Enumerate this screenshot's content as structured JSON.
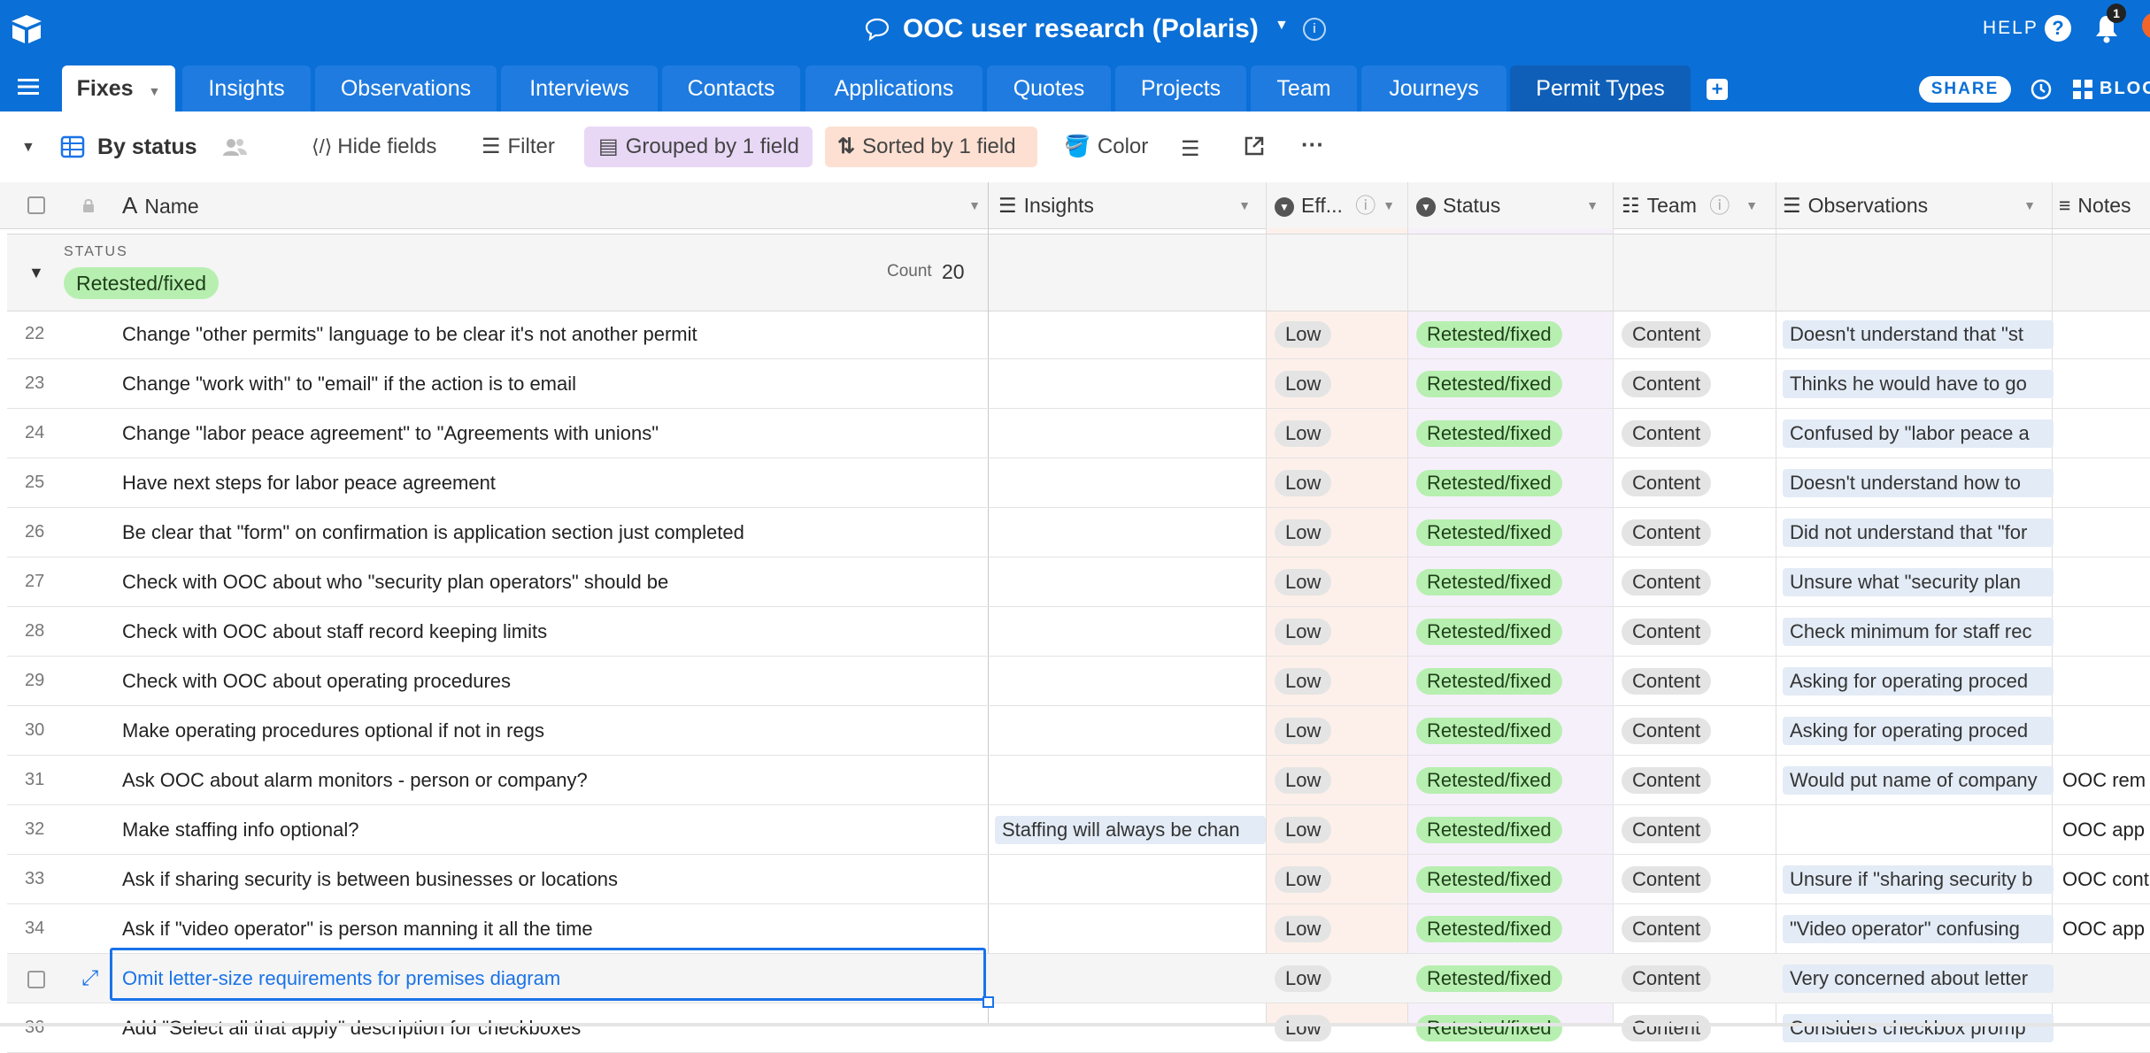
{
  "app": {
    "title": "OOC user research (Polaris)",
    "help_label": "HELP",
    "notification_count": "1",
    "share_label": "SHARE",
    "blocks_label": "BLOC"
  },
  "tabs": [
    {
      "label": "Fixes"
    },
    {
      "label": "Insights"
    },
    {
      "label": "Observations"
    },
    {
      "label": "Interviews"
    },
    {
      "label": "Contacts"
    },
    {
      "label": "Applications"
    },
    {
      "label": "Quotes"
    },
    {
      "label": "Projects"
    },
    {
      "label": "Team"
    },
    {
      "label": "Journeys"
    },
    {
      "label": "Permit Types"
    }
  ],
  "toolbar": {
    "view_name": "By status",
    "hide_fields": "Hide fields",
    "filter": "Filter",
    "grouped": "Grouped by 1 field",
    "sorted": "Sorted by 1 field",
    "color": "Color"
  },
  "columns": {
    "name": "Name",
    "insights": "Insights",
    "effort": "Eff...",
    "status": "Status",
    "team": "Team",
    "observations": "Observations",
    "notes": "Notes"
  },
  "group": {
    "field_label": "STATUS",
    "value": "Retested/fixed",
    "count_label": "Count",
    "count": "20"
  },
  "rows": [
    {
      "num": "22",
      "name": "Change \"other permits\" language to be clear it's not another permit",
      "insights": "",
      "effort": "Low",
      "status": "Retested/fixed",
      "team": "Content",
      "observations": "Doesn't understand that \"st",
      "notes": ""
    },
    {
      "num": "23",
      "name": "Change \"work with\" to \"email\" if the action is to email",
      "insights": "",
      "effort": "Low",
      "status": "Retested/fixed",
      "team": "Content",
      "observations": "Thinks he would have to go",
      "notes": ""
    },
    {
      "num": "24",
      "name": "Change \"labor peace agreement\" to \"Agreements with unions\"",
      "insights": "",
      "effort": "Low",
      "status": "Retested/fixed",
      "team": "Content",
      "observations": "Confused by \"labor peace a",
      "notes": ""
    },
    {
      "num": "25",
      "name": "Have next steps for labor peace agreement",
      "insights": "",
      "effort": "Low",
      "status": "Retested/fixed",
      "team": "Content",
      "observations": "Doesn't understand how to",
      "notes": ""
    },
    {
      "num": "26",
      "name": "Be clear that \"form\" on confirmation is application section just completed",
      "insights": "",
      "effort": "Low",
      "status": "Retested/fixed",
      "team": "Content",
      "observations": "Did not understand that \"for",
      "notes": ""
    },
    {
      "num": "27",
      "name": "Check with OOC about who \"security plan operators\" should be",
      "insights": "",
      "effort": "Low",
      "status": "Retested/fixed",
      "team": "Content",
      "observations": "Unsure what \"security plan",
      "notes": ""
    },
    {
      "num": "28",
      "name": "Check with OOC about staff record keeping limits",
      "insights": "",
      "effort": "Low",
      "status": "Retested/fixed",
      "team": "Content",
      "observations": "Check minimum for staff rec",
      "notes": ""
    },
    {
      "num": "29",
      "name": "Check with OOC about operating procedures",
      "insights": "",
      "effort": "Low",
      "status": "Retested/fixed",
      "team": "Content",
      "observations": "Asking for operating proced",
      "notes": ""
    },
    {
      "num": "30",
      "name": "Make operating procedures optional if not in regs",
      "insights": "",
      "effort": "Low",
      "status": "Retested/fixed",
      "team": "Content",
      "observations": "Asking for operating proced",
      "notes": ""
    },
    {
      "num": "31",
      "name": "Ask OOC about alarm monitors - person or company?",
      "insights": "",
      "effort": "Low",
      "status": "Retested/fixed",
      "team": "Content",
      "observations": "Would put name of company",
      "notes": "OOC rem"
    },
    {
      "num": "32",
      "name": "Make staffing info optional?",
      "insights": "Staffing will always be chan",
      "effort": "Low",
      "status": "Retested/fixed",
      "team": "Content",
      "observations": "",
      "notes": "OOC app"
    },
    {
      "num": "33",
      "name": "Ask if sharing security is between businesses or locations",
      "insights": "",
      "effort": "Low",
      "status": "Retested/fixed",
      "team": "Content",
      "observations": "Unsure if \"sharing security b",
      "notes": "OOC cont"
    },
    {
      "num": "34",
      "name": "Ask if \"video operator\" is person manning it all the time",
      "insights": "",
      "effort": "Low",
      "status": "Retested/fixed",
      "team": "Content",
      "observations": "\"Video operator\" confusing",
      "notes": "OOC app"
    },
    {
      "num": "",
      "name": "Omit letter-size requirements for premises diagram",
      "insights": "",
      "effort": "Low",
      "status": "Retested/fixed",
      "team": "Content",
      "observations": "Very concerned about letter",
      "notes": ""
    },
    {
      "num": "36",
      "name": "Add \"Select all that apply\" description for checkboxes",
      "insights": "",
      "effort": "Low",
      "status": "Retested/fixed",
      "team": "Content",
      "observations": "Considers checkbox promp",
      "notes": ""
    }
  ],
  "colors": {
    "brand": "#0a6fd6",
    "status_green": "#b7efb0",
    "effort_tint": "#fdf0ea",
    "status_tint": "#f6f0fb",
    "selected": "#1a73e8"
  }
}
